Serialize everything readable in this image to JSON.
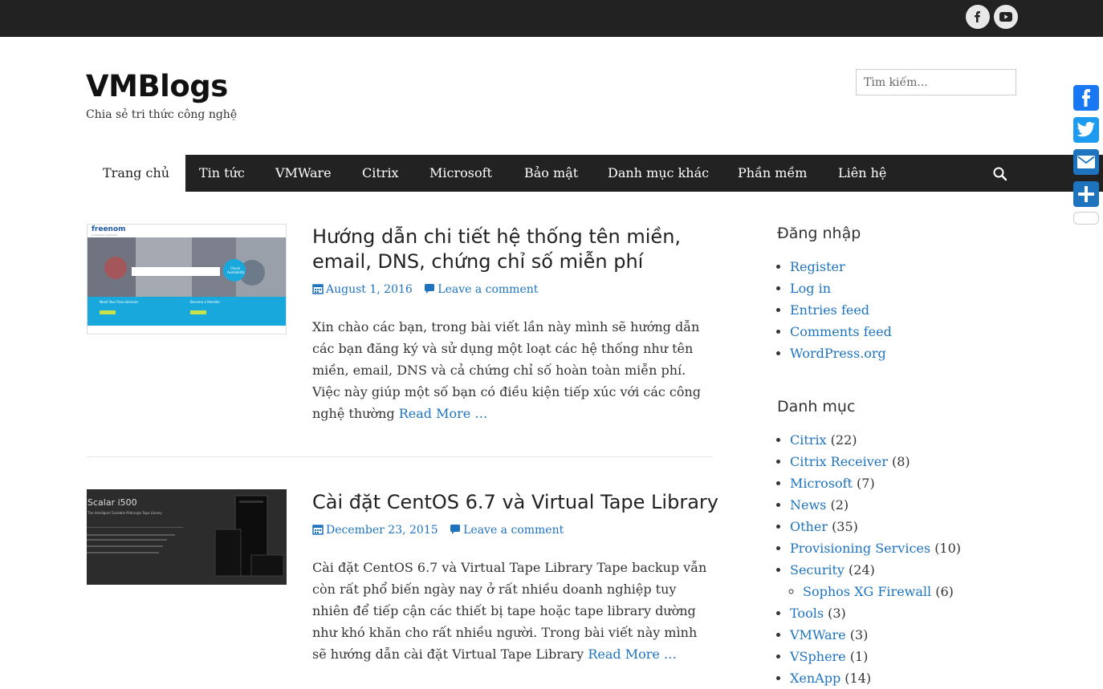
{
  "site": {
    "title": "VMBlogs",
    "tagline": "Chia sẻ tri thức công nghệ"
  },
  "social_icons": [
    "facebook-icon",
    "youtube-icon"
  ],
  "search": {
    "placeholder": "Tìm kiếm..."
  },
  "nav": {
    "items": [
      {
        "label": "Trang chủ",
        "active": true
      },
      {
        "label": "Tin tức"
      },
      {
        "label": "VMWare"
      },
      {
        "label": "Citrix"
      },
      {
        "label": "Microsoft"
      },
      {
        "label": "Bảo mật"
      },
      {
        "label": "Danh mục khác"
      },
      {
        "label": "Phần mềm"
      },
      {
        "label": "Liên hệ"
      }
    ]
  },
  "share_buttons": [
    "facebook",
    "twitter",
    "email",
    "share"
  ],
  "posts": [
    {
      "title": "Hướng dẫn chi tiết hệ thống tên miền, email, DNS, chứng chỉ số miễn phí",
      "date": "August 1, 2016",
      "comments": "Leave a comment",
      "excerpt": "Xin chào các bạn, trong bài viết lần này mình sẽ hướng dẫn các bạn đăng ký và sử dụng một loạt các hệ thống như tên miền, email, DNS và cả chứng chỉ số hoàn toàn miễn phí. Việc này giúp một số bạn có điều kiện tiếp xúc với các công nghệ thường",
      "read_more": "Read More …",
      "thumb_text": {
        "logo": "freenom",
        "sub": "A name for everyone",
        "check": "Check Availability",
        "left_heading": "Need Your Free domains",
        "right_heading": "Become a Reseller"
      }
    },
    {
      "title": "Cài đặt CentOS 6.7 và Virtual Tape Library",
      "date": "December 23, 2015",
      "comments": "Leave a comment",
      "excerpt": "Cài đặt CentOS 6.7 và Virtual Tape Library Tape backup vẫn còn rất phổ biến ngày nay ở rất nhiều doanh nghiệp tuy nhiên để tiếp cận các thiết bị tape hoặc tape library dường như khó khăn cho rất nhiều người. Trong bài viết này mình sẽ hướng dẫn cài đặt Virtual Tape Library",
      "read_more": "Read More …",
      "thumb_text": {
        "heading": "Scalar i500",
        "sub": "The Intelligent Scalable Midrange Tape Library"
      }
    }
  ],
  "widgets": {
    "login": {
      "title": "Đăng nhập",
      "links": [
        "Register",
        "Log in",
        "Entries feed",
        "Comments feed",
        "WordPress.org"
      ]
    },
    "categories": {
      "title": "Danh mục",
      "items": [
        {
          "name": "Citrix",
          "count": "(22)"
        },
        {
          "name": "Citrix Receiver",
          "count": "(8)"
        },
        {
          "name": "Microsoft",
          "count": "(7)"
        },
        {
          "name": "News",
          "count": "(2)"
        },
        {
          "name": "Other",
          "count": "(35)"
        },
        {
          "name": "Provisioning Services",
          "count": "(10)"
        },
        {
          "name": "Security",
          "count": "(24)"
        },
        {
          "name": "Sophos XG Firewall",
          "count": "(6)"
        },
        {
          "name": "Tools",
          "count": "(3)"
        },
        {
          "name": "VMWare",
          "count": "(3)"
        },
        {
          "name": "VSphere",
          "count": "(1)"
        },
        {
          "name": "XenApp",
          "count": "(14)"
        }
      ]
    }
  },
  "colors": {
    "link": "#1e73be",
    "dark_bar": "#222222"
  }
}
